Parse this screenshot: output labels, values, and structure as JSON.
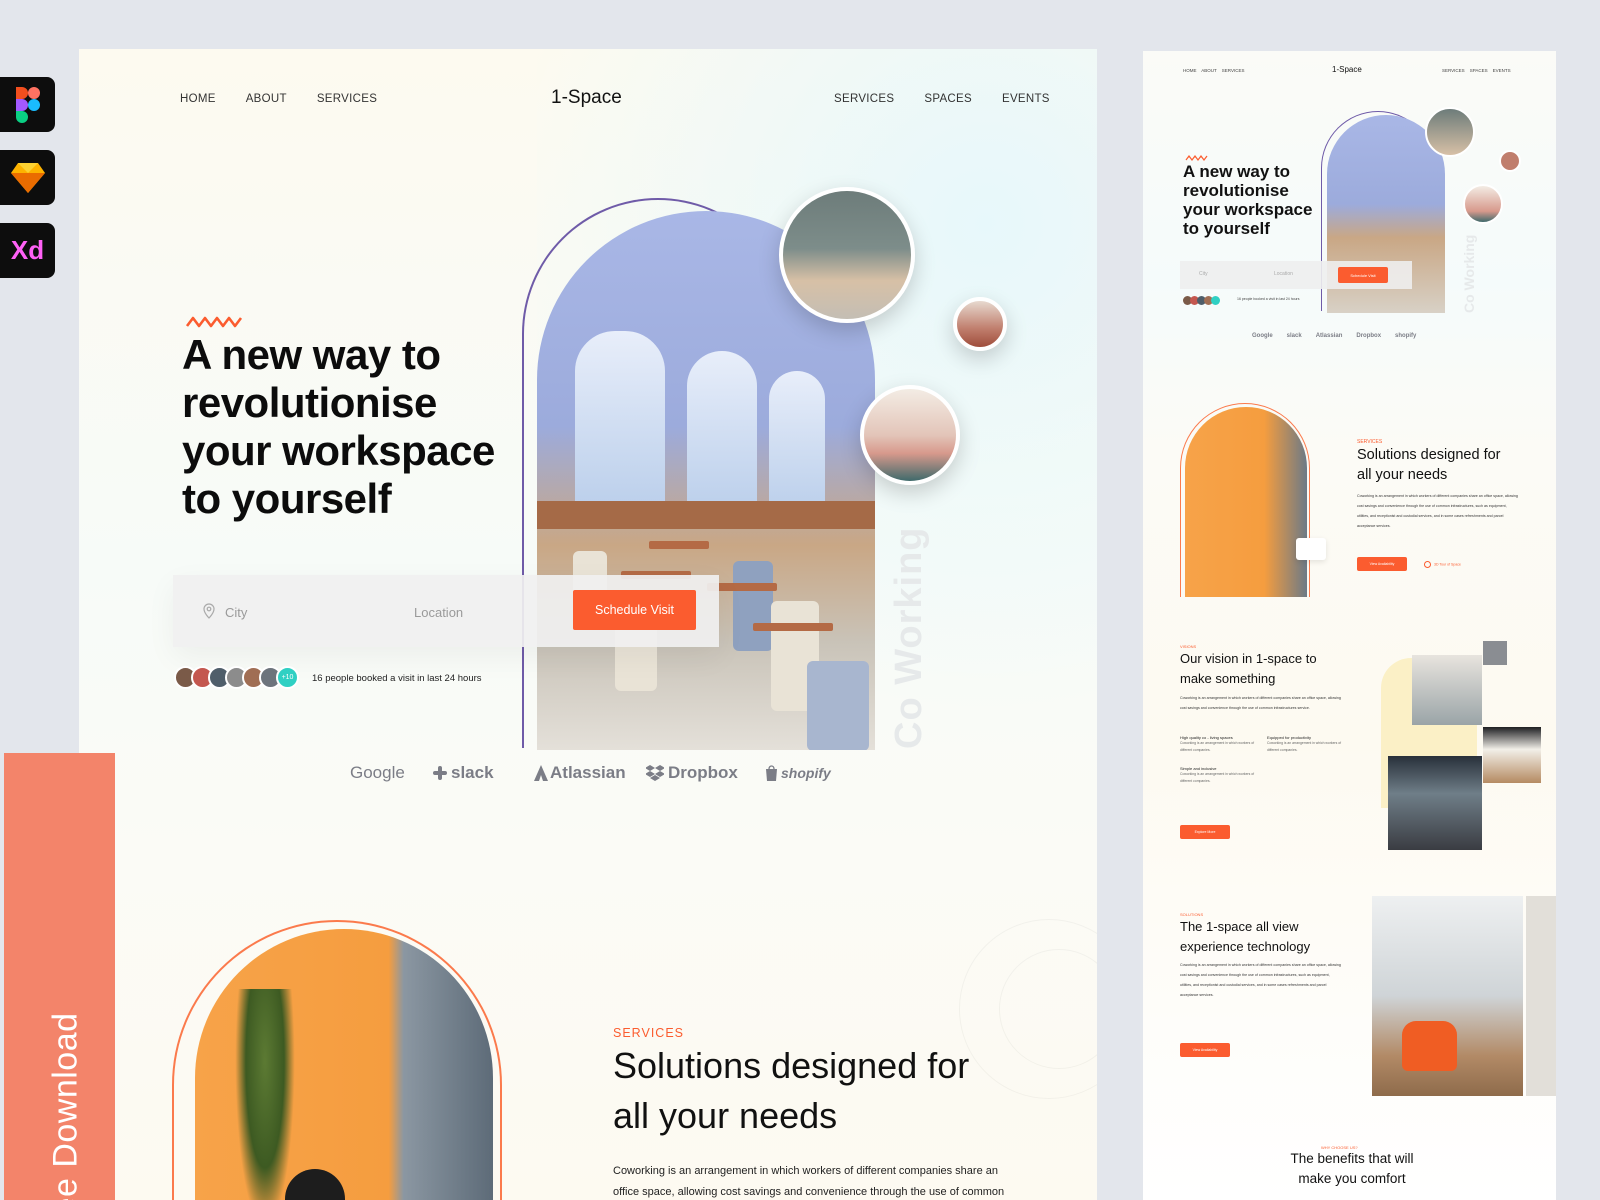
{
  "tool_badges": {
    "figma_label": "",
    "sketch_label": "",
    "xd_label": "Xd"
  },
  "free_download": "Free Download",
  "main": {
    "nav_left": [
      "HOME",
      "ABOUT",
      "SERVICES"
    ],
    "brand": "1-Space",
    "nav_right": [
      "SERVICES",
      "SPACES",
      "EVENTS"
    ],
    "hero_lines": [
      "A new way to",
      "revolutionise",
      "your workspace",
      "to yourself"
    ],
    "vertical_text": "Co Working",
    "search": {
      "city_placeholder": "City",
      "location_placeholder": "Location",
      "cta": "Schedule Visit"
    },
    "avatar_more": "+10",
    "booked_text": "16 people booked a visit in last 24 hours",
    "brands": [
      "Google",
      "slack",
      "Atlassian",
      "Dropbox",
      "shopify"
    ],
    "services": {
      "label": "SERVICES",
      "title_lines": [
        "Solutions designed for",
        "all your needs"
      ],
      "text_lines": [
        "Coworking is an arrangement in which workers of different companies share an",
        "office space, allowing cost savings and convenience through the use of common"
      ]
    }
  },
  "mobile": {
    "nav_left": [
      "HOME",
      "ABOUT",
      "SERVICES"
    ],
    "brand": "1-Space",
    "nav_right": [
      "SERVICES",
      "SPACES",
      "EVENTS"
    ],
    "hero_lines": [
      "A new way to",
      "revolutionise",
      "your workspace",
      "to yourself"
    ],
    "vertical_text": "Co Working",
    "search": {
      "city": "City",
      "location": "Location",
      "cta": "Schedule Visit"
    },
    "booked_text": "16 people booked a visit in last 24 hours",
    "brands": [
      "Google",
      "slack",
      "Atlassian",
      "Dropbox",
      "shopify"
    ],
    "services": {
      "label": "SERVICES",
      "title_lines": [
        "Solutions designed for",
        "all your needs"
      ],
      "text": "Coworking is an arrangement in which workers of different companies share an office space, allowing cost savings and convenience through the use of common infrastructures, such as equipment, utilities, and receptionist and custodial services, and in some cases refreshments and parcel acceptance services.",
      "cta": "View Availability",
      "tour": "3D Tour of Space"
    },
    "visions": {
      "label": "VISIONS",
      "title_lines": [
        "Our vision in 1-space to",
        "make something"
      ],
      "text": "Coworking is an arrangement in which workers of different companies share an office space, allowing cost savings and convenience through the use of common infrastructures service.",
      "features": [
        {
          "title": "High quality co - living spaces",
          "text": "Coworking is an arrangement in which workers of different companies."
        },
        {
          "title": "Equipped for productivity",
          "text": "Coworking is an arrangement in which workers of different companies."
        },
        {
          "title": "Simple and inclusive",
          "text": "Coworking is an arrangement in which workers of different companies."
        }
      ],
      "cta": "Explore More"
    },
    "solutions": {
      "label": "SOLUTIONS",
      "title_lines": [
        "The 1-space all view",
        "experience technology"
      ],
      "text": "Coworking is an arrangement in which workers of different companies share an office space, allowing cost savings and convenience through the use of common infrastructures, such as equipment, utilities, and receptionist and custodial services, and in some cases refreshments and parcel acceptance services.",
      "cta": "View Availability"
    },
    "why": {
      "label": "WHY CHOOSE US?",
      "title_lines": [
        "The benefits that will",
        "make you comfort"
      ]
    }
  },
  "colors": {
    "accent": "#fb5c2f",
    "free_download_bg": "#f3846a",
    "arch_purple": "#6f5ba8",
    "vertical_text": "#e6e9ea"
  }
}
